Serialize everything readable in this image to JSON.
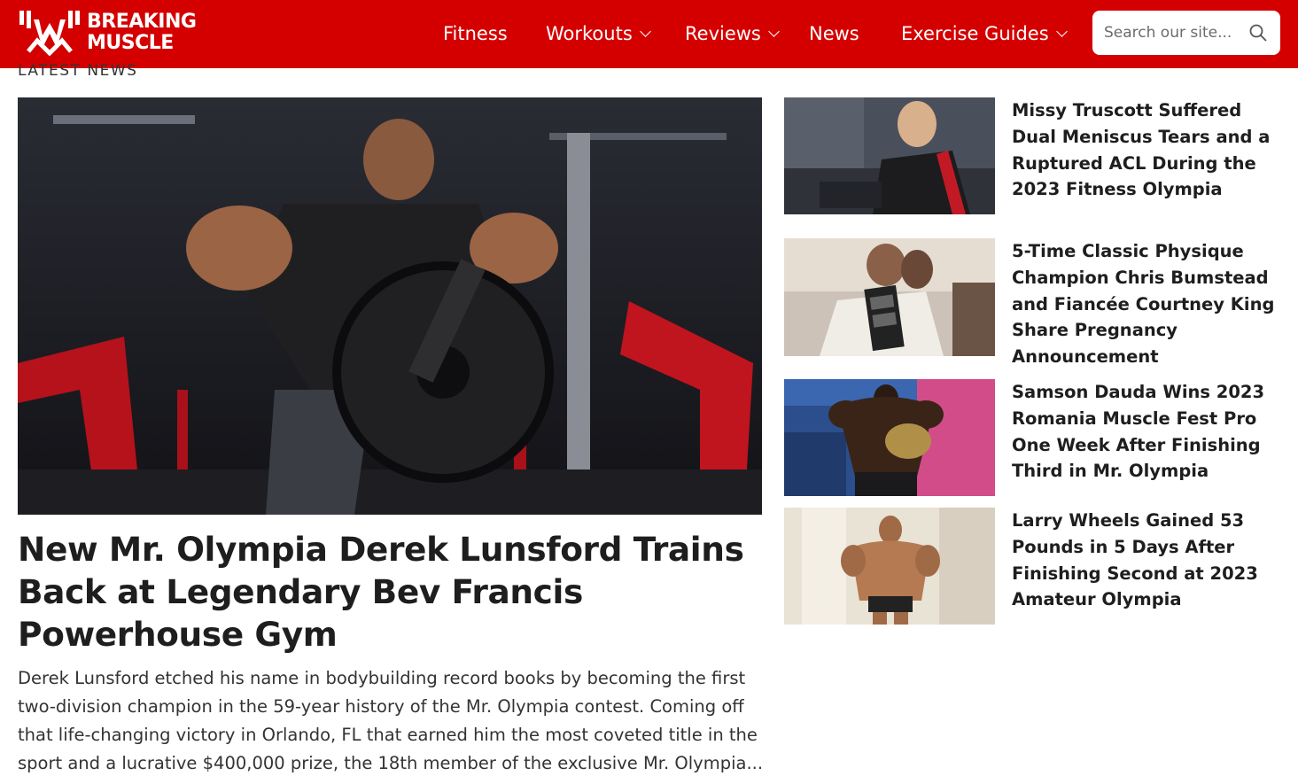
{
  "brand": {
    "logo_line1": "BREAKING",
    "logo_line2": "MUSCLE",
    "accent": "#d40000"
  },
  "nav": {
    "items": [
      {
        "label": "Fitness",
        "has_dropdown": false
      },
      {
        "label": "Workouts",
        "has_dropdown": true
      },
      {
        "label": "Reviews",
        "has_dropdown": true
      },
      {
        "label": "News",
        "has_dropdown": false
      },
      {
        "label": "Exercise Guides",
        "has_dropdown": true
      }
    ]
  },
  "search": {
    "placeholder": "Search our site...",
    "icon": "search-icon"
  },
  "section": {
    "label": "LATEST NEWS"
  },
  "featured": {
    "title": "New Mr. Olympia Derek Lunsford Trains Back at Legendary Bev Francis Powerhouse Gym",
    "excerpt": "Derek Lunsford etched his name in bodybuilding record books by becoming the first two-division champion in the 59-year history of the Mr. Olympia contest. Coming off that life-changing victory in Orlando, FL that earned him the most coveted title in the sport and a lucrative $400,000 prize, the 18th member of the exclusive Mr. Olympia..."
  },
  "side_articles": [
    {
      "title": "Missy Truscott Suffered Dual Meniscus Tears and a Ruptured ACL During the 2023 Fitness Olympia"
    },
    {
      "title": "5-Time Classic Physique Champion Chris Bumstead and Fiancée Courtney King Share Pregnancy Announcement"
    },
    {
      "title": "Samson Dauda Wins 2023 Romania Muscle Fest Pro One Week After Finishing Third in Mr. Olympia"
    },
    {
      "title": "Larry Wheels Gained 53 Pounds in 5 Days After Finishing Second at 2023 Amateur Olympia"
    }
  ]
}
